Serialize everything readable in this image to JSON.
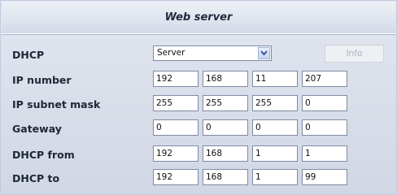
{
  "title": "Web server",
  "dhcp": {
    "label": "DHCP",
    "selected": "Server",
    "info_label": "Info"
  },
  "rows": [
    {
      "label": "IP number",
      "values": [
        "192",
        "168",
        "11",
        "207"
      ]
    },
    {
      "label": "IP subnet mask",
      "values": [
        "255",
        "255",
        "255",
        "0"
      ]
    },
    {
      "label": "Gateway",
      "values": [
        "0",
        "0",
        "0",
        "0"
      ]
    },
    {
      "label": "DHCP from",
      "values": [
        "192",
        "168",
        "1",
        "1"
      ]
    },
    {
      "label": "DHCP to",
      "values": [
        "192",
        "168",
        "1",
        "99"
      ]
    }
  ],
  "icons": {
    "dropdown": "chevron-down-icon"
  }
}
